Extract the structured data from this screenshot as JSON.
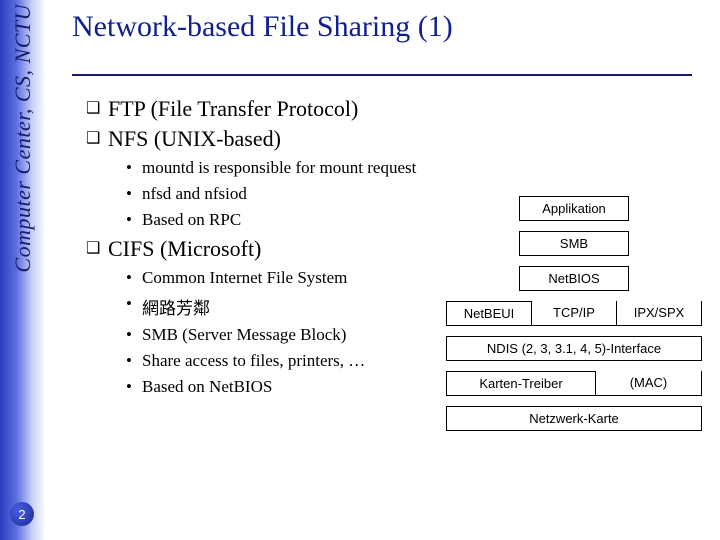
{
  "sidebar": {
    "text": "Computer Center, CS, NCTU"
  },
  "page_number": "2",
  "title": "Network-based File Sharing (1)",
  "bullets": {
    "ftp": "FTP (File Transfer Protocol)",
    "nfs": "NFS (UNIX-based)",
    "nfs_subs": {
      "a": "mountd is responsible for mount request",
      "b": "nfsd and nfsiod",
      "c": "Based on RPC"
    },
    "cifs": "CIFS (Microsoft)",
    "cifs_subs": {
      "a": "Common Internet File System",
      "b": "網路芳鄰",
      "c": "SMB (Server Message Block)",
      "d": "Share access to files, printers, …",
      "e": "Based on NetBIOS"
    }
  },
  "diagram": {
    "app": "Applikation",
    "smb": "SMB",
    "netbios": "NetBIOS",
    "netbeui": "NetBEUI",
    "tcpip": "TCP/IP",
    "ipxspx": "IPX/SPX",
    "ndis": "NDIS (2, 3, 3.1, 4, 5)-Interface",
    "driver": "Karten-Treiber",
    "mac": "(MAC)",
    "nic": "Netzwerk-Karte"
  }
}
